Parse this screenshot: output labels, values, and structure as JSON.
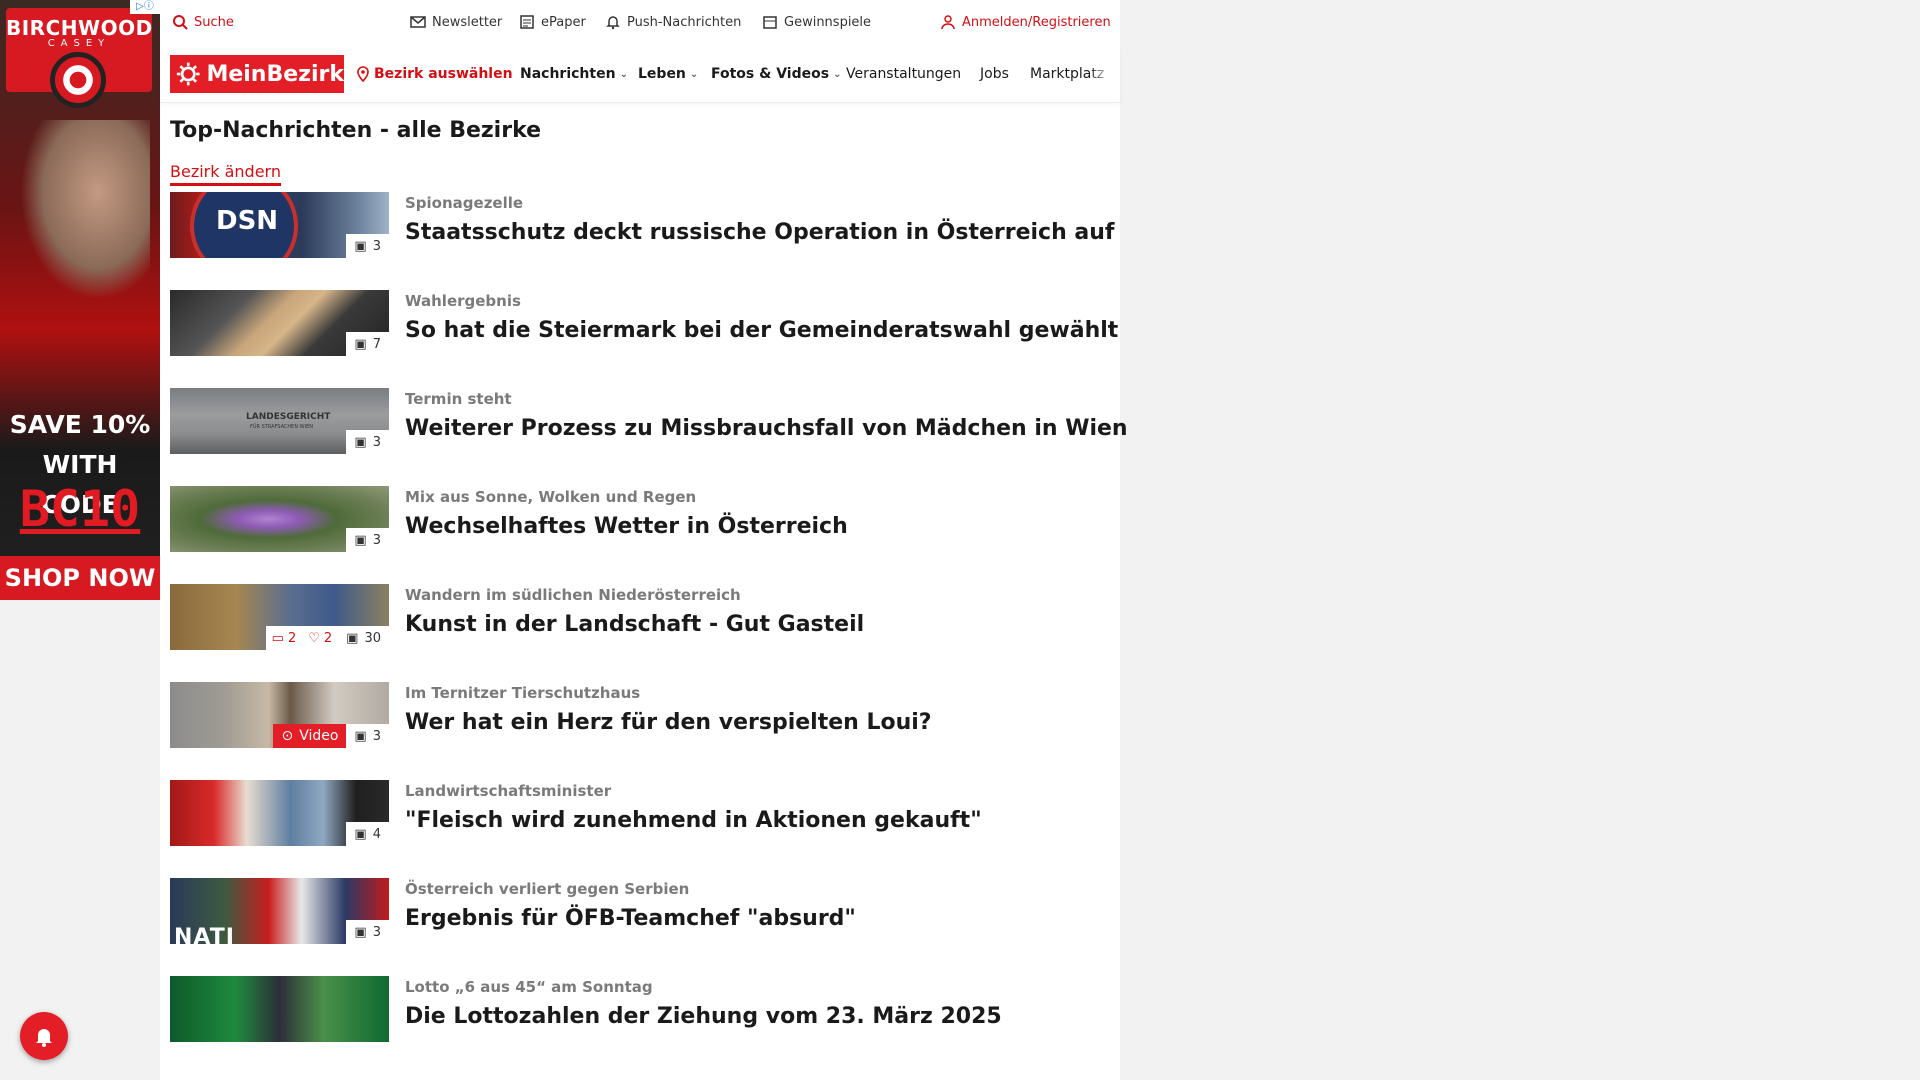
{
  "ad": {
    "brand": "BIRCHWOOD",
    "brand_sub": "CASEY",
    "line1": "SAVE 10%",
    "line2": "WITH CODE",
    "code": "BC10",
    "cta": "SHOP NOW"
  },
  "util": {
    "search": "Suche",
    "newsletter": "Newsletter",
    "epaper": "ePaper",
    "push": "Push-Nachrichten",
    "contests": "Gewinnspiele",
    "login": "Anmelden/Registrieren"
  },
  "nav": {
    "logo": "MeinBezirk",
    "district": "Bezirk auswählen",
    "items": [
      "Nachrichten",
      "Leben",
      "Fotos & Videos",
      "Veranstaltungen",
      "Jobs",
      "Marktplatz"
    ]
  },
  "page_title": "Top-Nachrichten - alle Bezirke",
  "change_link": "Bezirk ändern",
  "articles": [
    {
      "kicker": "Spionagezelle",
      "headline": "Staatsschutz deckt russische Operation in Österreich auf",
      "photos": "3"
    },
    {
      "kicker": "Wahlergebnis",
      "headline": "So hat die Steiermark bei der Gemeinderatswahl gewählt",
      "photos": "7"
    },
    {
      "kicker": "Termin steht",
      "headline": "Weiterer Prozess zu Missbrauchsfall von Mädchen in Wien",
      "photos": "3"
    },
    {
      "kicker": "Mix aus Sonne, Wolken und Regen",
      "headline": "Wechselhaftes Wetter in Österreich",
      "photos": "3"
    },
    {
      "kicker": "Wandern im südlichen Niederösterreich",
      "headline": "Kunst in der Landschaft - Gut Gasteil",
      "photos": "30",
      "comments": "2",
      "likes": "2"
    },
    {
      "kicker": "Im Ternitzer Tierschutzhaus",
      "headline": "Wer hat ein Herz für den verspielten Loui?",
      "photos": "3",
      "video": "Video"
    },
    {
      "kicker": "Landwirtschaftsminister",
      "headline": "\"Fleisch wird zunehmend in Aktionen gekauft\"",
      "photos": "4"
    },
    {
      "kicker": "Österreich verliert gegen Serbien",
      "headline": "Ergebnis für ÖFB-Teamchef \"absurd\"",
      "photos": "3"
    },
    {
      "kicker": "Lotto „6 aus 45“ am Sonntag",
      "headline": "Die Lottozahlen der Ziehung vom 23. März 2025"
    }
  ],
  "thumb_image_texts": {
    "dsn": "DSN",
    "court": "LANDESGERICHT",
    "court_sub": "FÜR STRAFSACHEN WIEN",
    "soccer": "NATI"
  },
  "colors": {
    "brand_red": "#e41e26",
    "link_red": "#d40f14"
  }
}
